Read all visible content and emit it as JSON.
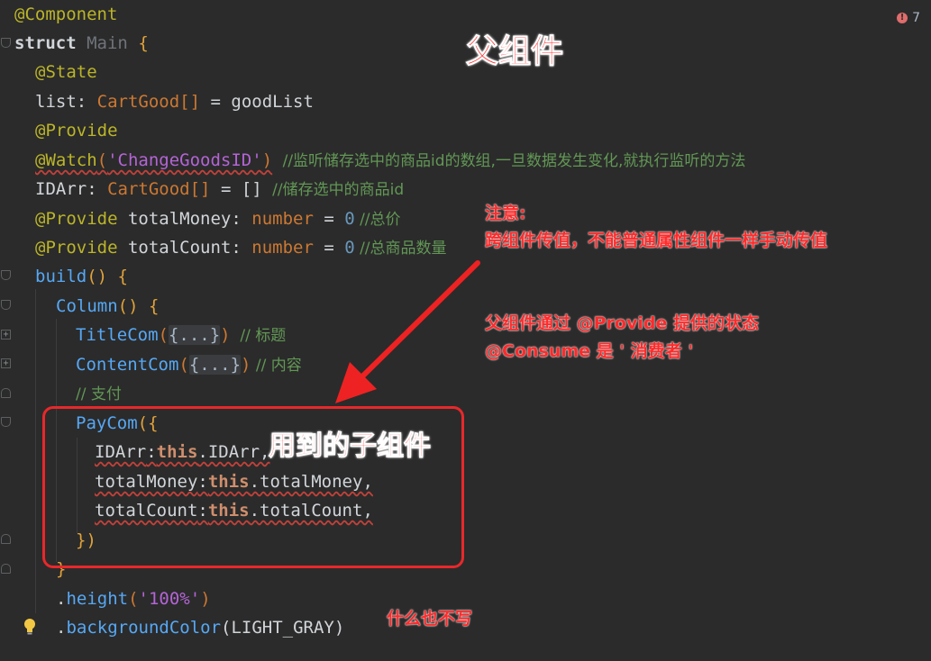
{
  "editor": {
    "status": {
      "warning_count": "7",
      "warning_icon": "error-circle-icon"
    },
    "code": {
      "l1_annotation": "@Component",
      "l2_struct_kw": "struct",
      "l2_name": "Main",
      "l2_brace": "{",
      "l3_annotation": "@State",
      "l4_name": "list",
      "l4_colon": ":",
      "l4_type": "CartGood[]",
      "l4_rest": " = goodList",
      "l5_annotation": "@Provide",
      "l6_annotation": "@Watch",
      "l6_paren_open": "(",
      "l6_string": "'ChangeGoodsID'",
      "l6_paren_close": ")",
      "l6_comment": "//监听储存选中的商品id的数组,一旦数据发生变化,就执行监听的方法",
      "l7_name": "IDArr",
      "l7_colon": ":",
      "l7_type": "CartGood[]",
      "l7_rest": " = [] ",
      "l7_comment": "//储存选中的商品id",
      "l8_annotation": "@Provide",
      "l8_name": " totalMoney",
      "l8_colon": ": ",
      "l8_type": "number",
      "l8_eq": " = ",
      "l8_num": "0",
      "l8_comment": " //总价",
      "l9_annotation": "@Provide",
      "l9_name": " totalCount",
      "l9_colon": ": ",
      "l9_type": "number",
      "l9_eq": " = ",
      "l9_num": "0",
      "l9_comment": " //总商品数量",
      "l10_fn": "build",
      "l10_rest": "() {",
      "l11_fn": "Column",
      "l11_rest": "() {",
      "l12_fn": "TitleCom",
      "l12_open": "(",
      "l12_fold": "{...}",
      "l12_close": ")",
      "l12_comment": "  // 标题",
      "l13_fn": "ContentCom",
      "l13_open": "(",
      "l13_fold": "{...}",
      "l13_close": ")",
      "l13_comment": " // 内容",
      "l14_comment": "// 支付",
      "l15_fn": "PayCom",
      "l15_rest": "({",
      "l16_prop": "IDArr",
      "l16_colon": ":",
      "l16_this": "this",
      "l16_rest": ".IDArr,",
      "l17_prop": "totalMoney",
      "l17_colon": ":",
      "l17_this": "this",
      "l17_rest": ".totalMoney,",
      "l18_prop": "totalCount",
      "l18_colon": ":",
      "l18_this": "this",
      "l18_rest": ".totalCount,",
      "l19_close": "})",
      "l20_close": "}",
      "l21_dot": ".",
      "l21_fn": "height",
      "l21_open": "(",
      "l21_str": "'100%'",
      "l21_close": ")",
      "l22_dot": ".",
      "l22_fn": "backgroundColor",
      "l22_rest": "(LIGHT_GRAY)"
    }
  },
  "annotations": {
    "title": "父组件",
    "note_heading": "注意:",
    "note_body": "跨组件传值，不能普通属性组件一样手动传值",
    "provide_note": "父组件通过 @Provide 提供的状态",
    "consume_note": "@Consume 是 ' 消费者 '",
    "child_note": "用到的子组件",
    "nothing_note": "什么也不写"
  },
  "colors": {
    "background": "#2b2b2b",
    "annotation_red": "#ff2a2a",
    "box_red": "#e8282b"
  }
}
